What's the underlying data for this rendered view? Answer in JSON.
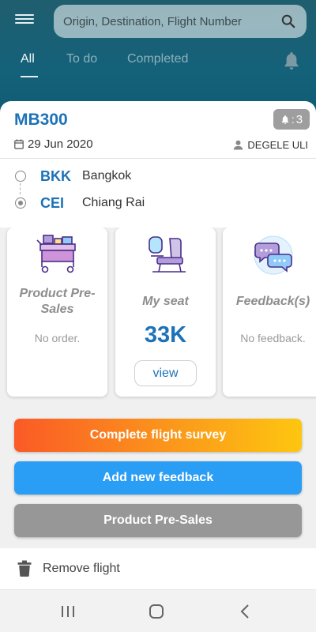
{
  "search": {
    "placeholder": "Origin, Destination, Flight Number"
  },
  "tabs": [
    {
      "label": "All",
      "active": true
    },
    {
      "label": "To do",
      "active": false
    },
    {
      "label": "Completed",
      "active": false
    }
  ],
  "flight": {
    "number": "MB300",
    "notification_count": "3",
    "date": "29 Jun 2020",
    "passenger": "DEGELE ULI",
    "origin": {
      "code": "BKK",
      "city": "Bangkok"
    },
    "destination": {
      "code": "CEI",
      "city": "Chiang Rai"
    }
  },
  "tiles": {
    "presales": {
      "title_line1": "Product Pre-",
      "title_line2": "Sales",
      "status": "No order."
    },
    "seat": {
      "title": "My seat",
      "value": "33K",
      "button": "view"
    },
    "feedback": {
      "title": "Feedback(s)",
      "status": "No feedback."
    }
  },
  "actions": {
    "survey": "Complete flight survey",
    "feedback": "Add new feedback",
    "presales": "Product Pre-Sales"
  },
  "remove": {
    "label": "Remove flight"
  },
  "colors": {
    "accent": "#1d72b8",
    "header": "#14617a",
    "feedback_button": "#2a9df4",
    "survey_gradient_start": "#fb5a26",
    "survey_gradient_end": "#fec610",
    "presales_button": "#979797"
  },
  "icons": [
    "menu-icon",
    "search-icon",
    "bell-icon",
    "calendar-icon",
    "person-icon",
    "cart-icon",
    "seat-icon",
    "chat-icon",
    "trash-icon",
    "recent-apps-icon",
    "home-icon",
    "back-icon"
  ]
}
